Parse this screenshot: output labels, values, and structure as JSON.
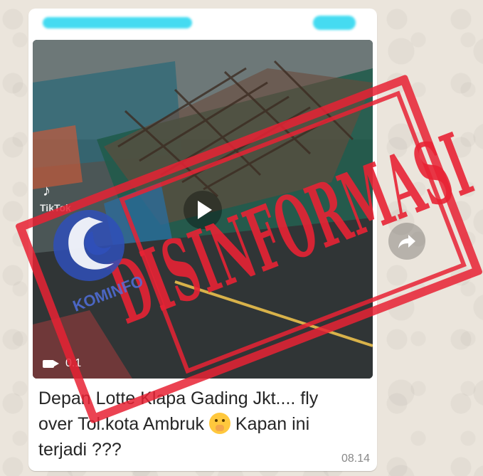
{
  "message": {
    "caption_line1": "Depan Lotte Klapa Gading Jkt.... fly",
    "caption_line2": "over  Tol.kota Ambruk",
    "caption_line3": "Kapan ini",
    "caption_line4": "terjadi ???",
    "time": "08.14",
    "emoji_icon": "face-with-hand-over-mouth-icon"
  },
  "video": {
    "watermark": "TikTok",
    "duration": "0.1",
    "play_icon": "play-icon",
    "camera_icon": "video-camera-icon"
  },
  "stamp": {
    "label": "DISINFORMASI",
    "color": "#e82234"
  },
  "logo": {
    "name": "KOMINFO",
    "color": "#3b5cc4"
  },
  "share_icon": "forward-share-icon"
}
